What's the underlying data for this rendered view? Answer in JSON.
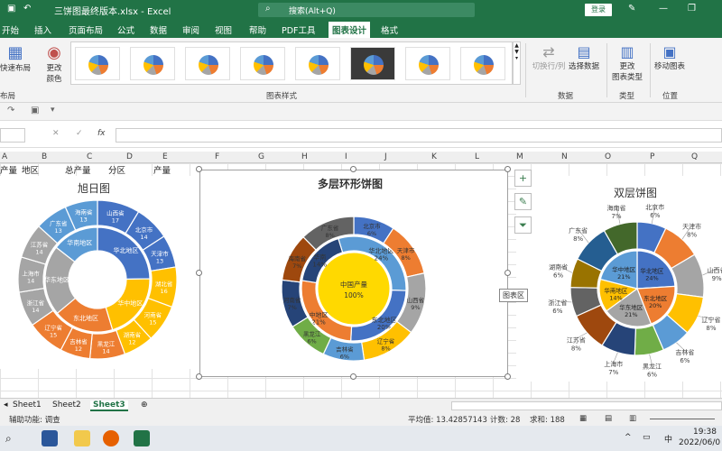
{
  "window": {
    "title": "三饼图最终版本.xlsx  -  Excel",
    "search_placeholder": "搜索(Alt+Q)",
    "login": "登录"
  },
  "tabs": [
    "开始",
    "插入",
    "页面布局",
    "公式",
    "数据",
    "审阅",
    "视图",
    "帮助",
    "PDF工具",
    "图表设计",
    "格式"
  ],
  "active_tab": "图表设计",
  "ribbon": {
    "quick_layout": "快速布局",
    "layout_group": "布局",
    "change_colors": "更改\n颜色",
    "chart_styles_group": "图表样式",
    "switch_row_col": "切换行/列",
    "select_data": "选择数据",
    "data_group": "数据",
    "change_type": "更改\n图表类型",
    "type_group": "类型",
    "move_chart": "移动图表",
    "location_group": "位置"
  },
  "formula_bar": {
    "fx": "fx"
  },
  "columns": [
    "A",
    "B",
    "C",
    "D",
    "E",
    "F",
    "G",
    "H",
    "I",
    "J",
    "K",
    "L",
    "M",
    "N",
    "O",
    "P",
    "Q"
  ],
  "header_row": [
    "产量",
    "地区",
    "总产量",
    "分区",
    "产量"
  ],
  "charts": {
    "sunburst_title": "旭日图",
    "doughnut_title": "多层环形饼图",
    "double_pie_title": "双层饼图"
  },
  "chart_data": [
    {
      "type": "sunburst",
      "title": "旭日图",
      "inner": [
        {
          "name": "华北地区",
          "value": 24
        },
        {
          "name": "华中地区",
          "value": 20
        },
        {
          "name": "东北地区",
          "value": 18
        },
        {
          "name": "华东地区",
          "value": 21
        },
        {
          "name": "华南地区",
          "value": 14
        }
      ],
      "outer": [
        {
          "name": "山西省",
          "value": 17
        },
        {
          "name": "北京市",
          "value": 14
        },
        {
          "name": "天津市",
          "value": 13
        },
        {
          "name": "湖北省",
          "value": 16
        },
        {
          "name": "河南省",
          "value": 15
        },
        {
          "name": "湖南省",
          "value": 12
        },
        {
          "name": "黑龙江",
          "value": 14
        },
        {
          "name": "吉林省",
          "value": 12
        },
        {
          "name": "辽宁省",
          "value": 15
        },
        {
          "name": "浙江省",
          "value": 14
        },
        {
          "name": "上海市",
          "value": 14
        },
        {
          "name": "江苏省",
          "value": 14
        },
        {
          "name": "广东省",
          "value": 13
        },
        {
          "name": "海南省",
          "value": 13
        }
      ]
    },
    {
      "type": "doughnut",
      "title": "多层环形饼图",
      "center_label": "中国产量",
      "center_value": "100%",
      "middle": [
        {
          "name": "华北地区",
          "value": "24%"
        },
        {
          "name": "东北地区",
          "value": "20%"
        },
        {
          "name": "中地区",
          "value": "21%"
        },
        {
          "name": "华南",
          "value": "14%"
        }
      ],
      "outer": [
        {
          "name": "北京市",
          "value": "6%"
        },
        {
          "name": "天津市",
          "value": "8%"
        },
        {
          "name": "山西省",
          "value": "9%"
        },
        {
          "name": "辽宁省",
          "value": "8%"
        },
        {
          "name": "吉林省",
          "value": "6%"
        },
        {
          "name": "黑龙江",
          "value": "6%"
        },
        {
          "name": "河南省",
          "value": "7%"
        },
        {
          "name": "海南省",
          "value": "7%"
        },
        {
          "name": "广东省",
          "value": "8%"
        }
      ]
    },
    {
      "type": "pie",
      "title": "双层饼图",
      "inner": [
        {
          "name": "华北地区",
          "value": "24%"
        },
        {
          "name": "东北地区",
          "value": "20%"
        },
        {
          "name": "华东地区",
          "value": "21%"
        },
        {
          "name": "华南地区",
          "value": "14%"
        },
        {
          "name": "华中地区",
          "value": "21%"
        }
      ],
      "outer": [
        {
          "name": "北京市",
          "value": "6%"
        },
        {
          "name": "天津市",
          "value": "8%"
        },
        {
          "name": "山西省",
          "value": "9%"
        },
        {
          "name": "辽宁省",
          "value": "8%"
        },
        {
          "name": "吉林省",
          "value": "6%"
        },
        {
          "name": "黑龙江",
          "value": "6%"
        },
        {
          "name": "上海市",
          "value": "7%"
        },
        {
          "name": "江苏省",
          "value": "8%"
        },
        {
          "name": "浙江省",
          "value": "6%"
        },
        {
          "name": "湖南省",
          "value": "6%"
        },
        {
          "name": "广东省",
          "value": "8%"
        },
        {
          "name": "海南省",
          "value": "7%"
        }
      ]
    }
  ],
  "chart_area_tooltip": "图表区",
  "sheet_tabs": [
    "Sheet1",
    "Sheet2",
    "Sheet3"
  ],
  "active_sheet": "Sheet3",
  "status": {
    "accessibility": "辅助功能: 调查",
    "average": "平均值: 13.42857143",
    "count": "计数: 28",
    "sum": "求和: 188"
  },
  "taskbar": {
    "ime": "中",
    "time": "19:38",
    "date": "2022/06/0"
  },
  "colors": {
    "excel_green": "#217346",
    "blue": "#4472c4",
    "orange": "#ed7d31",
    "gray": "#a5a5a5",
    "yellow": "#ffc000",
    "lightblue": "#5b9bd5",
    "green": "#70ad47"
  }
}
